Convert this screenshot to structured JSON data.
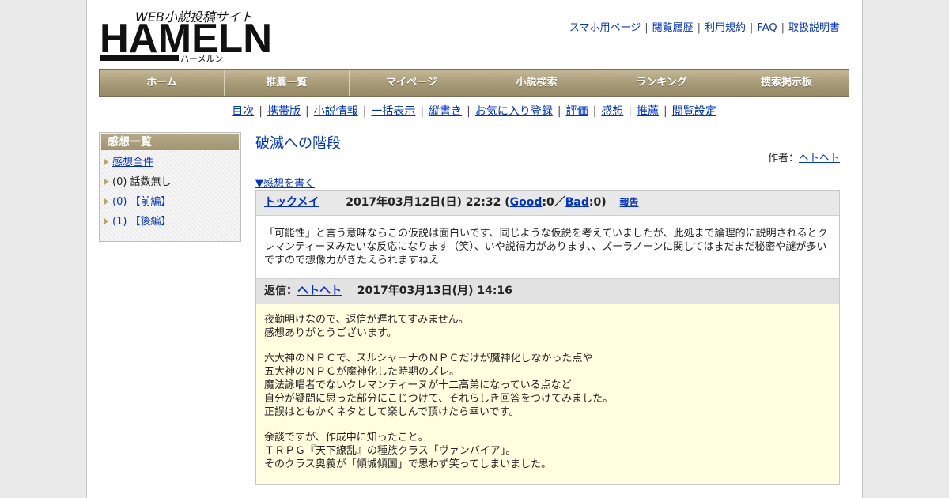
{
  "logo": {
    "tagline": "WEB小説投稿サイト",
    "name": "HAMELN",
    "kana": "ハーメルン"
  },
  "header_links": [
    "スマホ用ページ",
    "閲覧履歴",
    "利用規約",
    "FAQ",
    "取扱説明書"
  ],
  "main_nav": [
    "ホーム",
    "推薦一覧",
    "マイページ",
    "小説検索",
    "ランキング",
    "捜索掲示板"
  ],
  "sub_nav": [
    "目次",
    "携帯版",
    "小説情報",
    "一括表示",
    "縦書き",
    "お気に入り登録",
    "評価",
    "感想",
    "推薦",
    "閲覧設定"
  ],
  "sidebar": {
    "title": "感想一覧",
    "items": [
      {
        "label": "感想全件",
        "link": true
      },
      {
        "label": "(0) 話数無し",
        "link": false
      },
      {
        "label": "(0) 【前編】",
        "link": true
      },
      {
        "label": "(1) 【後編】",
        "link": true
      }
    ]
  },
  "story": {
    "title": "破滅への階段",
    "author_label": "作者：",
    "author": "ヘトヘト"
  },
  "write_review": "▼感想を書く",
  "review": {
    "user": "トックメイ",
    "date": "2017年03月12日(日) 22:32",
    "open_paren": "(",
    "good_label": "Good",
    "good_count": ":0／",
    "bad_label": "Bad",
    "bad_count": ":0)",
    "report": "報告",
    "body": "「可能性」と言う意味ならこの仮説は面白いです、同じような仮説を考えていましたが、此処まで論理的に説明されるとクレマンティーヌみたいな反応になります（笑）、いや説得力があります、、ズーラノーンに関してはまだまだ秘密や謎が多いですので想像力がきたえられますねえ"
  },
  "reply": {
    "label": "返信：",
    "user": "ヘトヘト",
    "date": "2017年03月13日(月) 14:16",
    "paragraphs": [
      [
        "夜勤明けなので、返信が遅れてすみません。",
        "感想ありがとうございます。"
      ],
      [
        "六大神のＮＰＣで、スルシャーナのＮＰＣだけが魔神化しなかった点や",
        "五大神のＮＰＣが魔神化した時期のズレ。",
        "魔法詠唱者でないクレマンティーヌが十二高弟になっている点など",
        "自分が疑問に思った部分にこじつけて、それらしき回答をつけてみました。",
        "正誤はともかくネタとして楽しんで頂けたら幸いです。"
      ],
      [
        "余談ですが、作成中に知ったこと。",
        "ＴＲＰＧ『天下繚乱』の種族クラス「ヴァンパイア」。",
        "そのクラス奥義が「傾城傾国」で思わず笑ってしまいました。"
      ]
    ]
  }
}
